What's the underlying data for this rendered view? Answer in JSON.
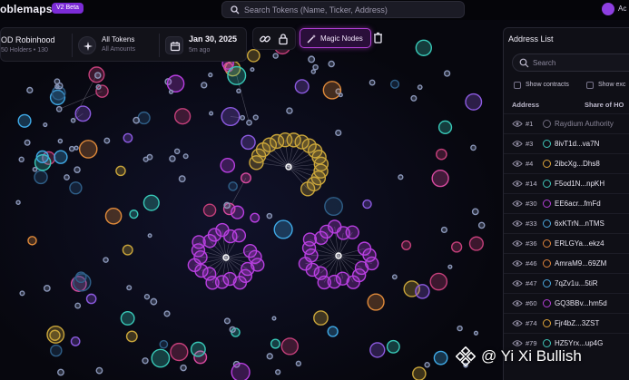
{
  "app": {
    "brand": "oblemaps",
    "badge": "V2 Beta",
    "search_placeholder": "Search Tokens (Name, Ticker, Address)",
    "user_label": "Ac",
    "accent_color": "#b13fd6"
  },
  "token": {
    "name": "OD Robinhood",
    "holders": "50 Holders • 130",
    "tokens_label": "All Tokens",
    "tokens_sub": "All Amounts",
    "date": "Jan 30, 2025",
    "date_sub": "5m ago"
  },
  "toolbar": {
    "magic_nodes_label": "Magic Nodes"
  },
  "address_list": {
    "title": "Address List",
    "search_placeholder": "Search",
    "show_contracts_label": "Show contracts",
    "show_exchanges_label": "Show exc",
    "col_address": "Address",
    "col_share": "Share of HO",
    "rows": [
      {
        "rank": "#1",
        "address": "Raydium Authority",
        "color": "#6e6a7c",
        "muted": true
      },
      {
        "rank": "#3",
        "address": "8ivT1d...va7N",
        "color": "#3fc6b9"
      },
      {
        "rank": "#4",
        "address": "2ibcXg...Dhs8",
        "color": "#e0a43a"
      },
      {
        "rank": "#14",
        "address": "F5od1N...npKH",
        "color": "#3fc6b9"
      },
      {
        "rank": "#30",
        "address": "EE6acr...fmFd",
        "color": "#b33fd6"
      },
      {
        "rank": "#33",
        "address": "6xKTrN...nTMS",
        "color": "#4aa8e0"
      },
      {
        "rank": "#36",
        "address": "ERLGYa...ekz4",
        "color": "#e0843a"
      },
      {
        "rank": "#46",
        "address": "AmraM9...69ZM",
        "color": "#e0843a"
      },
      {
        "rank": "#47",
        "address": "7qZv1u...5tiR",
        "color": "#4aa8e0"
      },
      {
        "rank": "#60",
        "address": "GQ3BBv...hm5d",
        "color": "#b33fd6"
      },
      {
        "rank": "#74",
        "address": "Fjr4bZ...3ZST",
        "color": "#e0a43a"
      },
      {
        "rank": "#79",
        "address": "HZ5Yrx...up4G",
        "color": "#3fc6b9"
      }
    ]
  },
  "watermark": {
    "text": "@ Yi Xi Bullish"
  },
  "graph": {
    "colors": [
      "#b83fe0",
      "#c9a53a",
      "#38c9b8",
      "#d94aa0",
      "#3fa9e6",
      "#e08a3a",
      "#8c5ae0",
      "#2f5f88",
      "#c43f7a"
    ]
  }
}
